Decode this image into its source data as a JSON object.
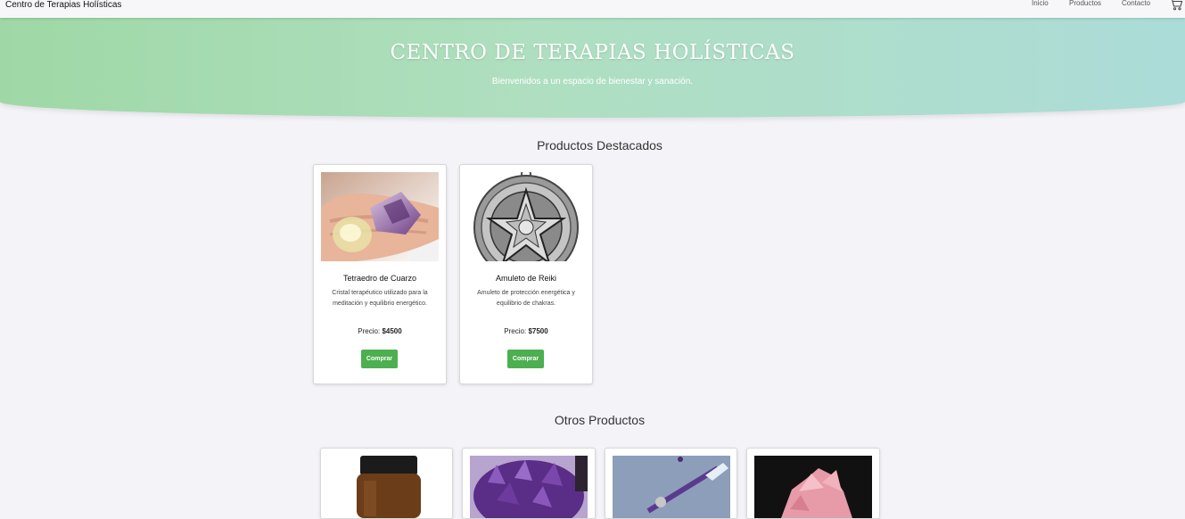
{
  "header": {
    "brand": "Centro de Terapias Holísticas",
    "nav": [
      "Inicio",
      "Productos",
      "Contacto"
    ],
    "cart_icon": "cart-icon"
  },
  "hero": {
    "title": "CENTRO DE TERAPIAS HOLÍSTICAS",
    "subtitle": "Bienvenidos a un espacio de bienestar y sanación."
  },
  "featured": {
    "title": "Productos Destacados",
    "products": [
      {
        "name": "Tetraedro de Cuarzo",
        "description": "Cristal terapéutico utilizado para la meditación y equilibrio energético.",
        "price_label": "Precio:",
        "price": "$4500",
        "button": "Comprar"
      },
      {
        "name": "Amuleto de Reiki",
        "description": "Amuleto de protección energética y equilibrio de chakras.",
        "price_label": "Precio:",
        "price": "$7500",
        "button": "Comprar"
      }
    ]
  },
  "others": {
    "title": "Otros Productos"
  },
  "colors": {
    "accent": "#4caf50",
    "hero_start": "#9fd8a6",
    "hero_end": "#acdcd8"
  }
}
